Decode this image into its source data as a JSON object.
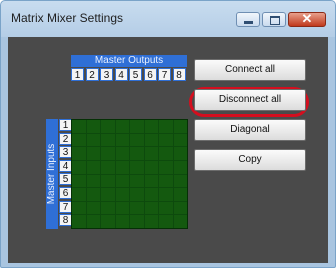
{
  "window": {
    "title": "Matrix Mixer Settings",
    "controls": [
      "minimize",
      "maximize",
      "close"
    ],
    "close_glyph": "✕"
  },
  "matrix": {
    "outputs_label": "Master Outputs",
    "inputs_label": "Master Inputs",
    "columns": [
      "1",
      "2",
      "3",
      "4",
      "5",
      "6",
      "7",
      "8"
    ],
    "rows": [
      "1",
      "2",
      "3",
      "4",
      "5",
      "6",
      "7",
      "8"
    ],
    "cell_color": "#14590f"
  },
  "buttons": {
    "connect_all": "Connect all",
    "disconnect_all": "Disconnect all",
    "diagonal": "Diagonal",
    "copy": "Copy"
  },
  "annotation": {
    "color": "#d40e1e",
    "target": "Connect all"
  }
}
